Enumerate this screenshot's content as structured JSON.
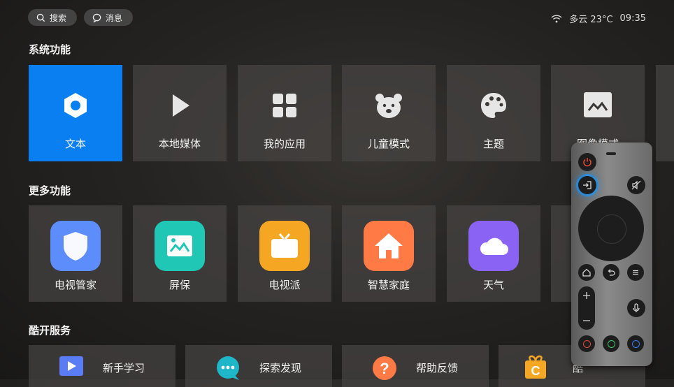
{
  "topbar": {
    "search_label": "搜索",
    "message_label": "消息",
    "weather": "多云 23°C",
    "time": "09:35"
  },
  "sections": {
    "system": "系统功能",
    "more": "更多功能",
    "services": "酷开服务"
  },
  "system_tiles": [
    {
      "label": "文本",
      "icon": "hexagon-settings-icon",
      "selected": true
    },
    {
      "label": "本地媒体",
      "icon": "play-icon"
    },
    {
      "label": "我的应用",
      "icon": "apps-grid-icon"
    },
    {
      "label": "儿童模式",
      "icon": "bear-icon"
    },
    {
      "label": "主题",
      "icon": "palette-icon"
    },
    {
      "label": "图像模式",
      "icon": "image-mode-icon"
    }
  ],
  "more_tiles": [
    {
      "label": "电视管家",
      "icon": "shield-icon",
      "color": "#5d8dfb"
    },
    {
      "label": "屏保",
      "icon": "picture-icon",
      "color": "#1fc7b4"
    },
    {
      "label": "电视派",
      "icon": "tv-icon",
      "color": "#f5a623"
    },
    {
      "label": "智慧家庭",
      "icon": "home-icon",
      "color": "#ff7a45"
    },
    {
      "label": "天气",
      "icon": "cloud-icon",
      "color": "#8a63f5"
    }
  ],
  "service_tiles": [
    {
      "label": "新手学习",
      "icon": "video-icon",
      "color": "#5a7cf5"
    },
    {
      "label": "探索发现",
      "icon": "chat-dots-icon",
      "color": "#1fb6c9"
    },
    {
      "label": "帮助反馈",
      "icon": "question-icon",
      "color": "#ff7a45"
    },
    {
      "label": "酷",
      "icon": "gift-c-icon",
      "color": "#f5a623"
    }
  ],
  "colors": {
    "accent": "#0a7ff2",
    "power": "#e0453a"
  }
}
